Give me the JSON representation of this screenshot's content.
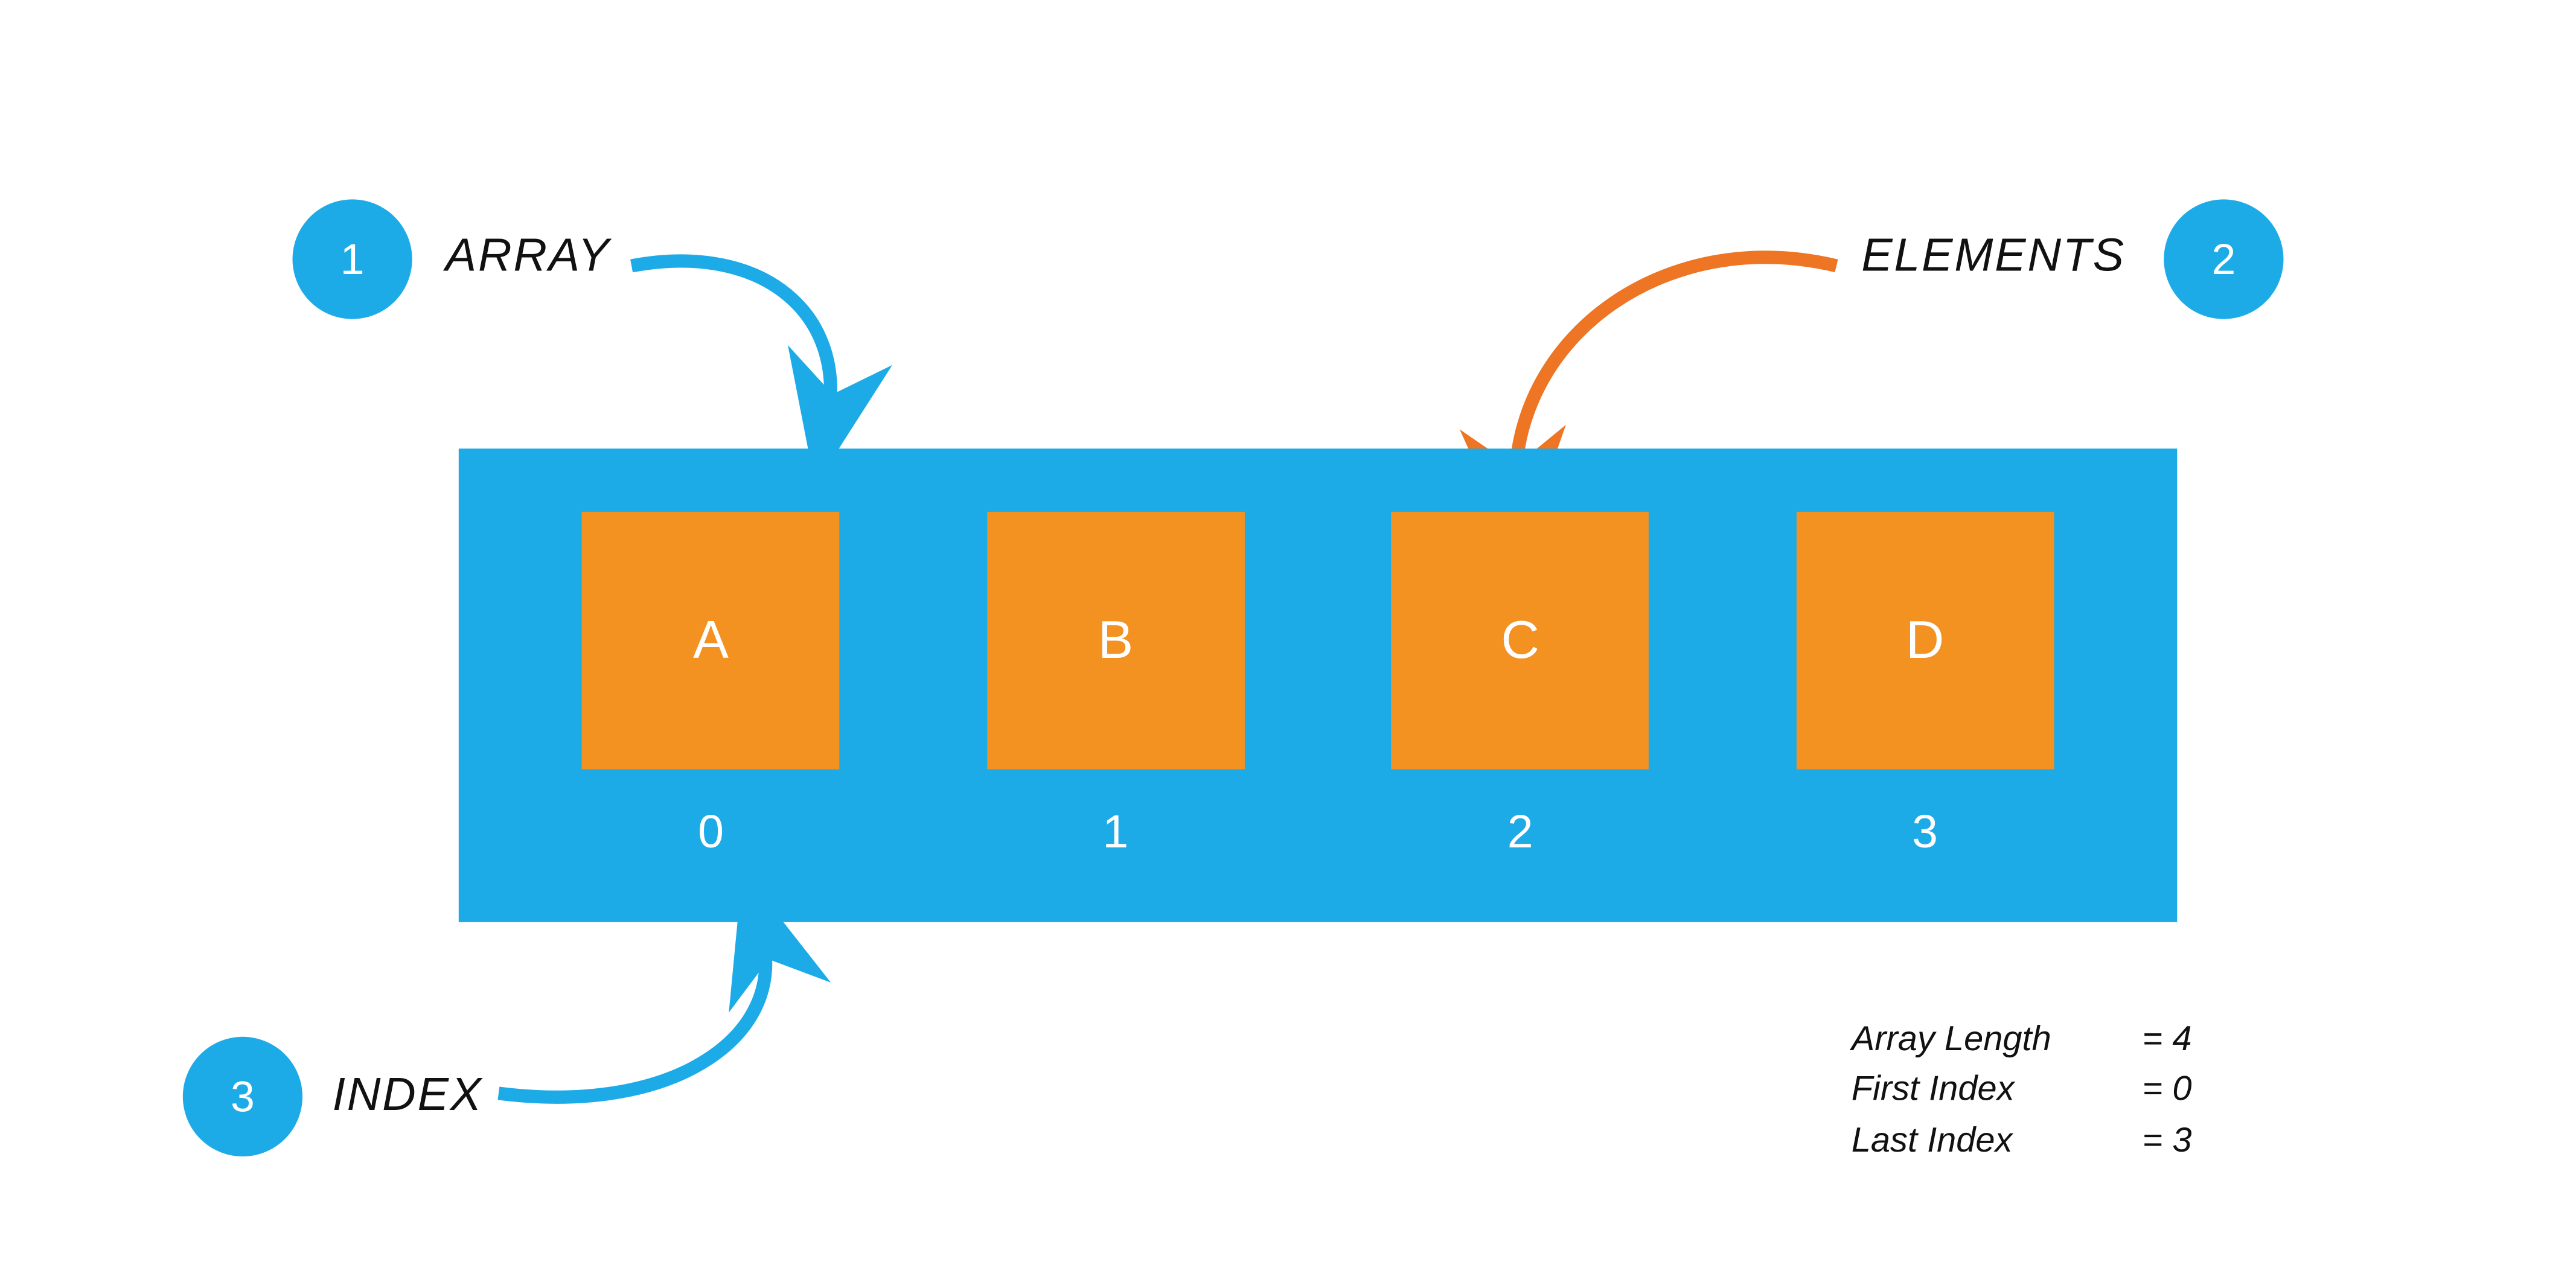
{
  "badges": {
    "array": {
      "num": "1",
      "label": "ARRAY"
    },
    "elements": {
      "num": "2",
      "label": "ELEMENTS"
    },
    "index": {
      "num": "3",
      "label": "INDEX"
    }
  },
  "array": {
    "cells": [
      {
        "value": "A",
        "index": "0"
      },
      {
        "value": "B",
        "index": "1"
      },
      {
        "value": "C",
        "index": "2"
      },
      {
        "value": "D",
        "index": "3"
      }
    ]
  },
  "info": [
    {
      "key": "Array Length",
      "val": "= 4"
    },
    {
      "key": "First Index",
      "val": "= 0"
    },
    {
      "key": "Last Index",
      "val": "= 3"
    }
  ],
  "colors": {
    "blue": "#1dabe8",
    "orange": "#f39121"
  }
}
